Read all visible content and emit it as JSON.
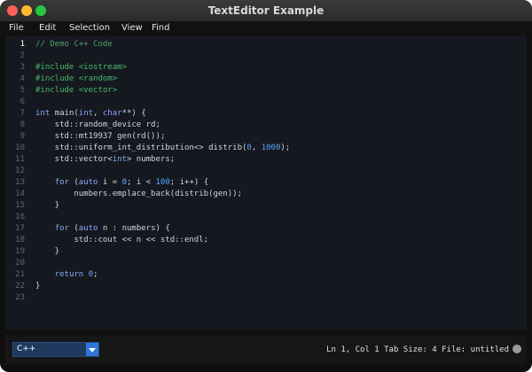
{
  "window": {
    "title": "TextEditor Example"
  },
  "menu": [
    "File",
    "Edit",
    "Selection",
    "View",
    "Find"
  ],
  "editor": {
    "active_line": 1,
    "lines": [
      {
        "n": 1,
        "t": "// Demo C++ Code"
      },
      {
        "n": 2,
        "t": ""
      },
      {
        "n": 3,
        "t": "#include <iostream>"
      },
      {
        "n": 4,
        "t": "#include <random>"
      },
      {
        "n": 5,
        "t": "#include <vector>"
      },
      {
        "n": 6,
        "t": ""
      },
      {
        "n": 7,
        "t": "int main(int, char**) {"
      },
      {
        "n": 8,
        "t": "    std::random_device rd;"
      },
      {
        "n": 9,
        "t": "    std::mt19937 gen(rd());"
      },
      {
        "n": 10,
        "t": "    std::uniform_int_distribution<> distrib(0, 1000);"
      },
      {
        "n": 11,
        "t": "    std::vector<int> numbers;"
      },
      {
        "n": 12,
        "t": ""
      },
      {
        "n": 13,
        "t": "    for (auto i = 0; i < 100; i++) {"
      },
      {
        "n": 14,
        "t": "        numbers.emplace_back(distrib(gen));"
      },
      {
        "n": 15,
        "t": "    }"
      },
      {
        "n": 16,
        "t": ""
      },
      {
        "n": 17,
        "t": "    for (auto n : numbers) {"
      },
      {
        "n": 18,
        "t": "        std::cout << n << std::endl;"
      },
      {
        "n": 19,
        "t": "    }"
      },
      {
        "n": 20,
        "t": ""
      },
      {
        "n": 21,
        "t": "    return 0;"
      },
      {
        "n": 22,
        "t": "}"
      },
      {
        "n": 23,
        "t": ""
      }
    ]
  },
  "status": {
    "language": "C++",
    "text": "Ln 1, Col 1  Tab Size: 4  File: untitled"
  },
  "icons": {
    "dropdown": "chevron-down-icon",
    "status": "status-dot-icon"
  },
  "colors": {
    "editor_bg": "#15191f",
    "comment": "#4ea16c",
    "keyword": "#89a7ff",
    "number": "#5aa8ff",
    "preprocessor": "#49b86a"
  }
}
